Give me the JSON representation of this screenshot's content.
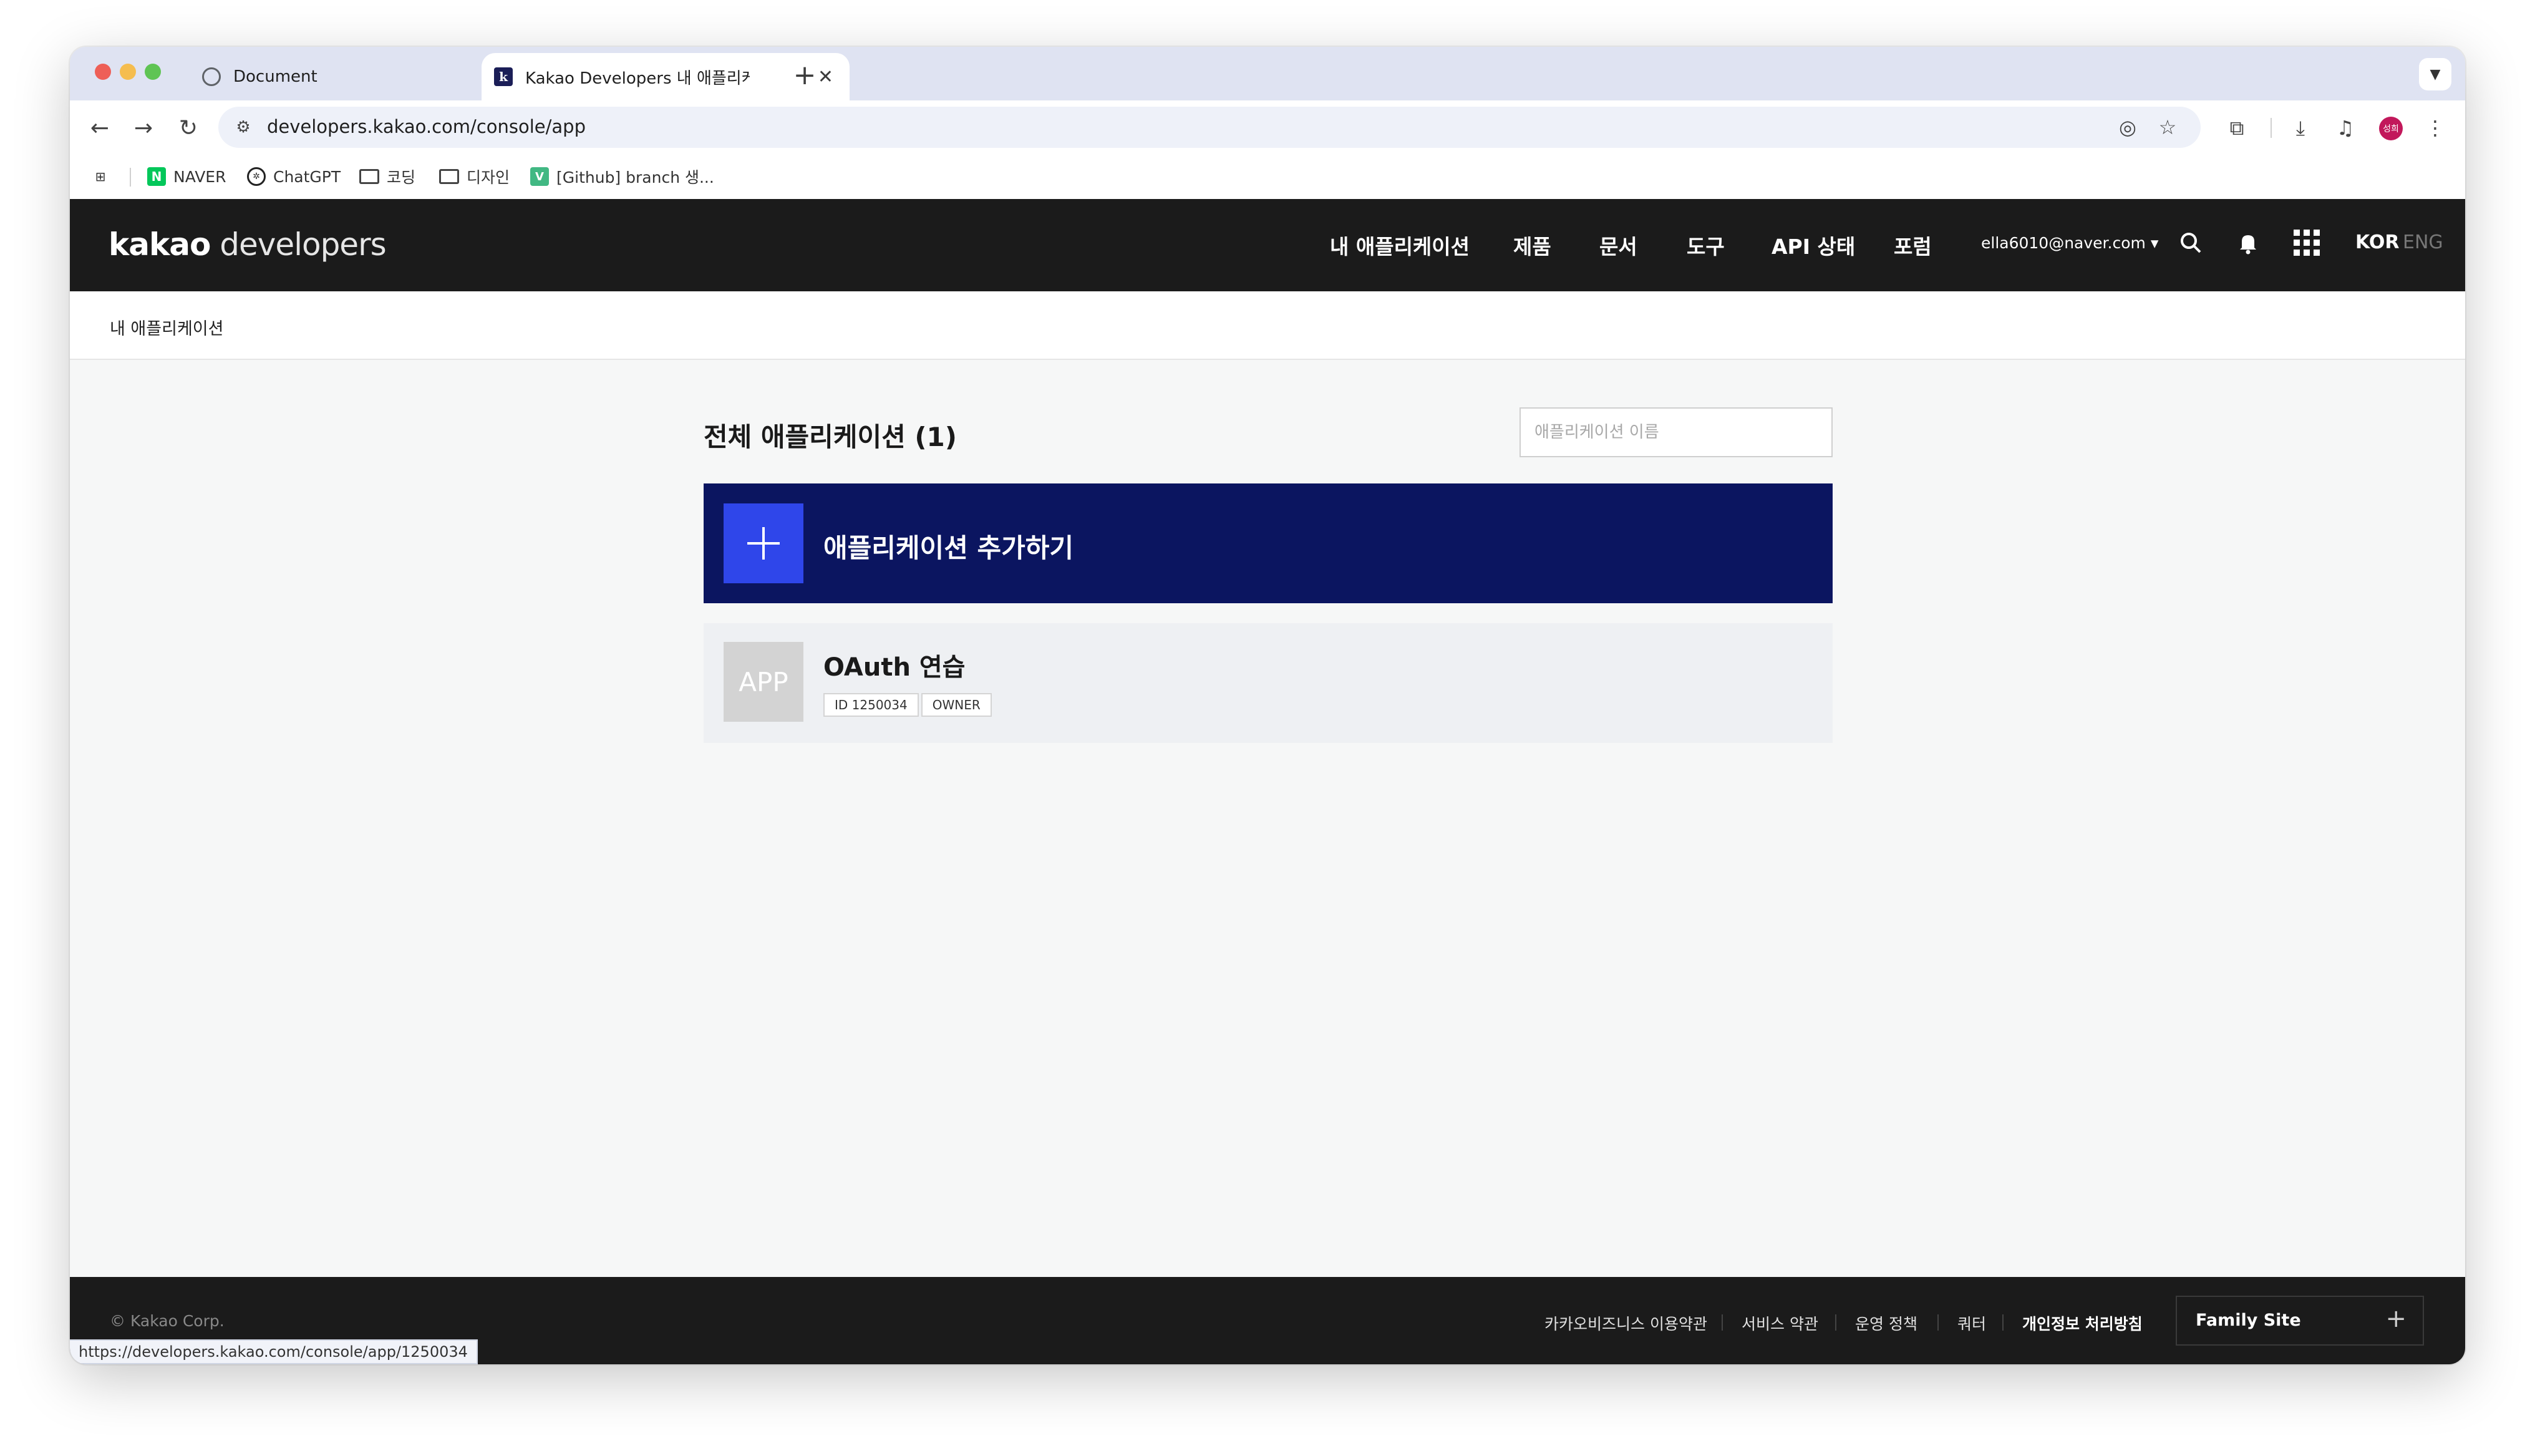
{
  "browser": {
    "tabs": [
      {
        "title": "Document",
        "icon": "globe-icon"
      },
      {
        "title": "Kakao Developers 내 애플리케이",
        "icon": "kakao-k-icon"
      }
    ],
    "url": "developers.kakao.com/console/app",
    "profile_initials": "성희",
    "bookmarks": [
      {
        "label": "NAVER",
        "icon": "naver-icon"
      },
      {
        "label": "ChatGPT",
        "icon": "chatgpt-icon"
      },
      {
        "label": "코딩",
        "icon": "folder-icon"
      },
      {
        "label": "디자인",
        "icon": "folder-icon"
      },
      {
        "label": "[Github] branch 생...",
        "icon": "vue-icon"
      }
    ],
    "status_url": "https://developers.kakao.com/console/app/1250034",
    "colors": {
      "tab_strip": "#dfe3f2",
      "omnibox": "#eef1f9",
      "profile": "#c2185b"
    }
  },
  "header": {
    "logo_strong": "kakao",
    "logo_light": " developers",
    "nav": [
      "내 애플리케이션",
      "제품",
      "문서",
      "도구",
      "API 상태",
      "포럼"
    ],
    "account": "ella6010@naver.com ▾",
    "lang_active": "KOR",
    "lang_inactive": "ENG"
  },
  "breadcrumb": "내 애플리케이션",
  "main": {
    "title": "전체 애플리케이션 (1)",
    "search_placeholder": "애플리케이션 이름",
    "add_app_label": "애플리케이션 추가하기",
    "apps": [
      {
        "thumb": "APP",
        "name": "OAuth 연습",
        "id_tag": "ID 1250034",
        "role_tag": "OWNER"
      }
    ],
    "colors": {
      "add_bg": "#0b1560",
      "add_plus_bg": "#2f46ea",
      "card_bg": "#eef0f3"
    }
  },
  "footer": {
    "copyright": "© Kakao Corp.",
    "links": [
      "카카오비즈니스 이용약관",
      "서비스 약관",
      "운영 정책",
      "쿼터",
      "개인정보 처리방침"
    ],
    "family_site": "Family Site"
  }
}
